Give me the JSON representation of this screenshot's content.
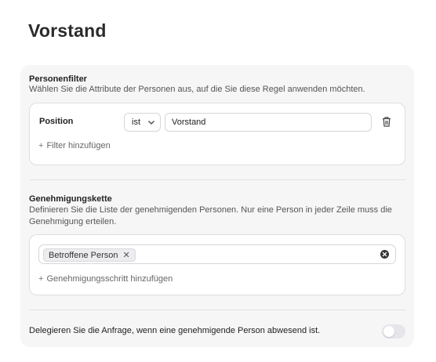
{
  "page": {
    "title": "Vorstand"
  },
  "person_filter": {
    "title": "Personenfilter",
    "description": "Wählen Sie die Attribute der Personen aus, auf die Sie diese Regel anwenden möchten.",
    "conditions": [
      {
        "attribute": "Position",
        "operator": "ist",
        "value": "Vorstand"
      }
    ],
    "add_filter_label": "Filter hinzufügen"
  },
  "approval_chain": {
    "title": "Genehmigungskette",
    "description": "Definieren Sie die Liste der genehmigenden Personen. Nur eine Person in jeder Zeile muss die Genehmigung erteilen.",
    "steps": [
      {
        "approvers": [
          "Betroffene Person"
        ]
      }
    ],
    "add_step_label": "Genehmigungsschritt hinzufügen"
  },
  "delegation": {
    "label": "Delegieren Sie die Anfrage, wenn eine genehmigende Person abwesend ist.",
    "enabled": false
  }
}
